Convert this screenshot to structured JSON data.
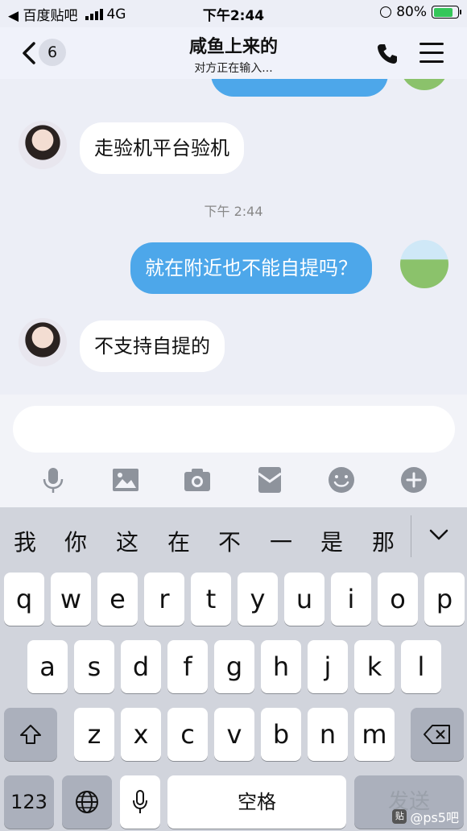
{
  "status_bar": {
    "carrier": "◀ 百度贴吧",
    "network": "4G",
    "time": "下午2:44",
    "battery": "80%"
  },
  "header": {
    "back_count": "6",
    "title": "咸鱼上来的",
    "subtitle": "对方正在输入..."
  },
  "messages": [
    {
      "side": "in",
      "text": "走验机平台验机"
    },
    {
      "side": "out",
      "text": "就在附近也不能自提吗？"
    },
    {
      "side": "in",
      "text": "不支持自提的"
    }
  ],
  "timestamp": "下午 2:44",
  "input": {
    "placeholder": ""
  },
  "toolbar": [
    "mic-icon",
    "image-icon",
    "camera-icon",
    "red-packet-icon",
    "emoji-icon",
    "plus-icon"
  ],
  "keyboard": {
    "candidates": [
      "我",
      "你",
      "这",
      "在",
      "不",
      "一",
      "是",
      "那"
    ],
    "row1": [
      "q",
      "w",
      "e",
      "r",
      "t",
      "y",
      "u",
      "i",
      "o",
      "p"
    ],
    "row2": [
      "a",
      "s",
      "d",
      "f",
      "g",
      "h",
      "j",
      "k",
      "l"
    ],
    "row3": [
      "z",
      "x",
      "c",
      "v",
      "b",
      "n",
      "m"
    ],
    "num_label": "123",
    "space_label": "空格",
    "send_label": "发送"
  },
  "watermark": {
    "badge": "贴",
    "text": "@ps5吧"
  }
}
